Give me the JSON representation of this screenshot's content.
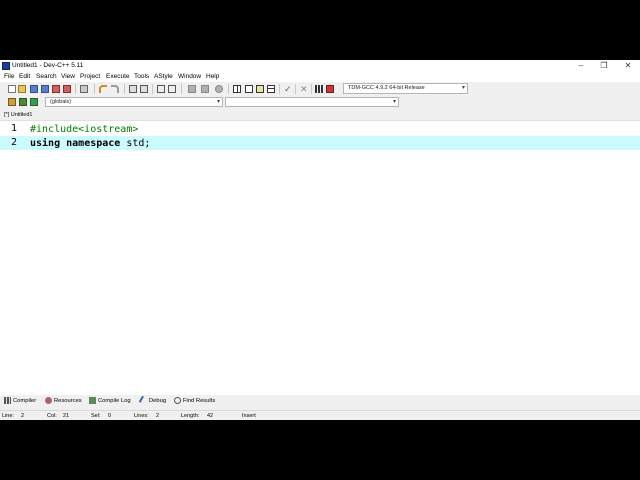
{
  "window": {
    "title": "Untitled1 - Dev-C++ 5.11",
    "minimize": "–",
    "restore": "❐",
    "close": "✕"
  },
  "menu": [
    "File",
    "Edit",
    "Search",
    "View",
    "Project",
    "Execute",
    "Tools",
    "AStyle",
    "Window",
    "Help"
  ],
  "toolbar": {
    "compiler_select": "TDM-GCC 4.9.2 64-bit Release",
    "class_select": "(globals)",
    "member_select": ""
  },
  "editor": {
    "tab": "[*] Untitled1",
    "lines": [
      {
        "num": "1",
        "parts": [
          {
            "t": "#include<iostream>",
            "c": "pp"
          }
        ]
      },
      {
        "num": "2",
        "parts": [
          {
            "t": "using",
            "c": "kw"
          },
          {
            "t": " ",
            "c": ""
          },
          {
            "t": "namespace",
            "c": "kw"
          },
          {
            "t": " std;",
            "c": ""
          }
        ]
      }
    ]
  },
  "bottom_tabs": [
    "Compiler",
    "Resources",
    "Compile Log",
    "Debug",
    "Find Results"
  ],
  "status": {
    "line_label": "Line:",
    "line_val": "2",
    "col_label": "Col:",
    "col_val": "21",
    "sel_label": "Sel:",
    "sel_val": "0",
    "lines_label": "Lines:",
    "lines_val": "2",
    "length_label": "Length:",
    "length_val": "42",
    "mode": "Insert"
  },
  "colors": {
    "active_line": "#ccfbff",
    "preprocessor": "#008000",
    "window_bg": "#f0f0f0"
  },
  "icons": {
    "toolbar1": [
      "new-file-icon",
      "open-icon",
      "save-icon",
      "save-all-icon",
      "close-file-icon",
      "close-all-icon",
      "print-icon",
      "undo-icon",
      "redo-icon",
      "find-icon",
      "replace-icon",
      "goto-icon",
      "indent-icon",
      "unindent-icon",
      "toggle-bookmark-icon",
      "goto-bookmark-icon",
      "compile-icon",
      "run-icon",
      "compile-run-icon",
      "rebuild-icon",
      "syntax-check-icon",
      "stop-icon",
      "profile-icon",
      "debug-icon"
    ],
    "toolbar2": [
      "new-class-icon",
      "insert-icon",
      "bookmark-icon"
    ]
  }
}
